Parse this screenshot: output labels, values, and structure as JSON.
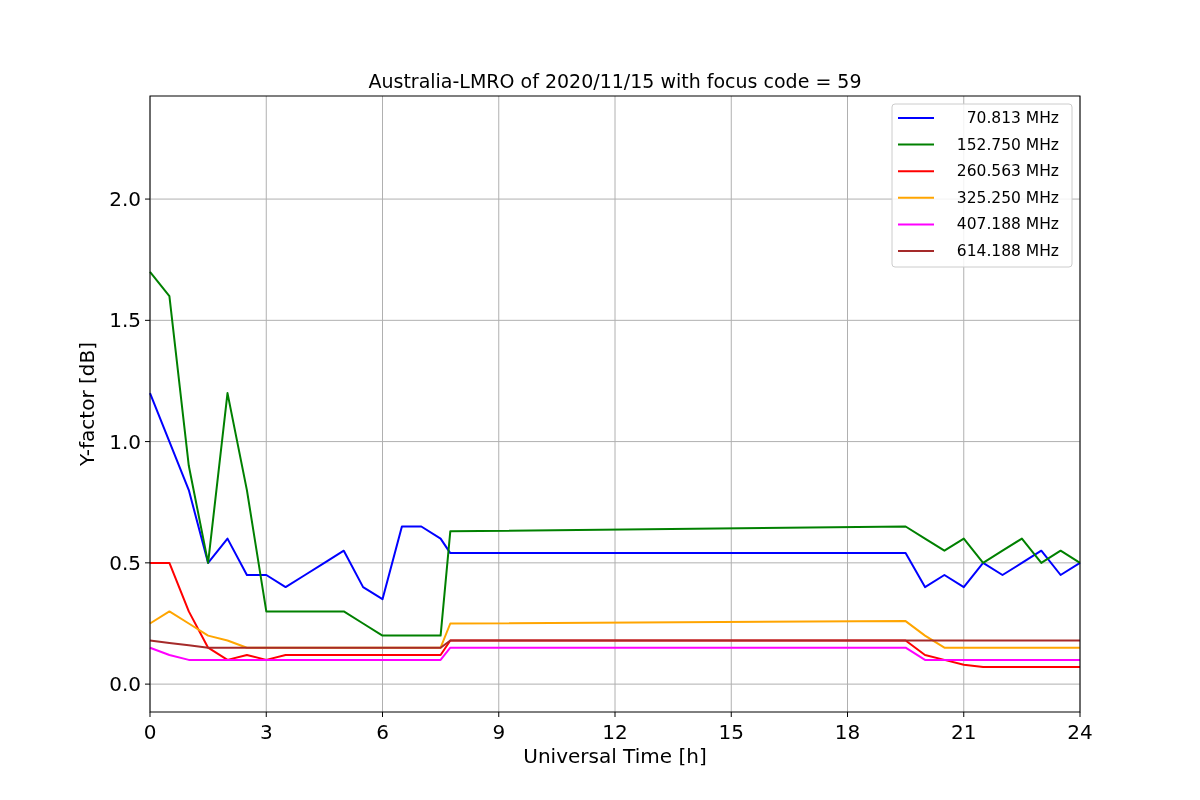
{
  "chart_data": {
    "type": "line",
    "title": "Australia-LMRO of 2020/11/15 with focus code = 59",
    "xlabel": "Universal Time [h]",
    "ylabel": "Y-factor [dB]",
    "x": [
      0,
      0.5,
      1,
      1.5,
      2,
      2.5,
      3,
      3.5,
      4,
      4.5,
      5,
      5.5,
      6,
      6.5,
      7,
      7.5,
      7.75,
      19.5,
      20,
      20.5,
      21,
      21.5,
      22,
      22.5,
      23,
      23.5,
      24
    ],
    "series": [
      {
        "name": "70.813 MHz",
        "color": "#0000ff",
        "values": [
          1.2,
          1.0,
          0.8,
          0.5,
          0.6,
          0.45,
          0.45,
          0.4,
          0.45,
          0.5,
          0.55,
          0.4,
          0.35,
          0.65,
          0.65,
          0.6,
          0.54,
          0.54,
          0.4,
          0.45,
          0.4,
          0.5,
          0.45,
          0.5,
          0.55,
          0.45,
          0.5
        ]
      },
      {
        "name": "152.750 MHz",
        "color": "#008000",
        "values": [
          1.7,
          1.6,
          0.9,
          0.5,
          1.2,
          0.8,
          0.3,
          0.3,
          0.3,
          0.3,
          0.3,
          0.25,
          0.2,
          0.2,
          0.2,
          0.2,
          0.63,
          0.65,
          0.6,
          0.55,
          0.6,
          0.5,
          0.55,
          0.6,
          0.5,
          0.55,
          0.5
        ]
      },
      {
        "name": "260.563 MHz",
        "color": "#ff0000",
        "values": [
          0.5,
          0.5,
          0.3,
          0.15,
          0.1,
          0.12,
          0.1,
          0.12,
          0.12,
          0.12,
          0.12,
          0.12,
          0.12,
          0.12,
          0.12,
          0.12,
          0.18,
          0.18,
          0.12,
          0.1,
          0.08,
          0.07,
          0.07,
          0.07,
          0.07,
          0.07,
          0.07
        ]
      },
      {
        "name": "325.250 MHz",
        "color": "#ffa500",
        "values": [
          0.25,
          0.3,
          0.25,
          0.2,
          0.18,
          0.15,
          0.15,
          0.15,
          0.15,
          0.15,
          0.15,
          0.15,
          0.15,
          0.15,
          0.15,
          0.15,
          0.25,
          0.26,
          0.2,
          0.15,
          0.15,
          0.15,
          0.15,
          0.15,
          0.15,
          0.15,
          0.15
        ]
      },
      {
        "name": "407.188 MHz",
        "color": "#ff00ff",
        "values": [
          0.15,
          0.12,
          0.1,
          0.1,
          0.1,
          0.1,
          0.1,
          0.1,
          0.1,
          0.1,
          0.1,
          0.1,
          0.1,
          0.1,
          0.1,
          0.1,
          0.15,
          0.15,
          0.1,
          0.1,
          0.1,
          0.1,
          0.1,
          0.1,
          0.1,
          0.1,
          0.1
        ]
      },
      {
        "name": "614.188 MHz",
        "color": "#a52a2a",
        "values": [
          0.18,
          0.17,
          0.16,
          0.15,
          0.15,
          0.15,
          0.15,
          0.15,
          0.15,
          0.15,
          0.15,
          0.15,
          0.15,
          0.15,
          0.15,
          0.15,
          0.18,
          0.18,
          0.18,
          0.18,
          0.18,
          0.18,
          0.18,
          0.18,
          0.18,
          0.18,
          0.18
        ]
      }
    ],
    "grid": true,
    "legend": true,
    "xlim": [
      0,
      24
    ],
    "ylim": [
      -0.115,
      2.425
    ],
    "xticks": [
      0,
      3,
      6,
      9,
      12,
      15,
      18,
      21,
      24
    ],
    "yticks": [
      {
        "value": 0,
        "label": "0.0"
      },
      {
        "value": 0.5,
        "label": "0.5"
      },
      {
        "value": 1,
        "label": "1.0"
      },
      {
        "value": 1.5,
        "label": "1.5"
      },
      {
        "value": 2,
        "label": "2.0"
      }
    ]
  }
}
